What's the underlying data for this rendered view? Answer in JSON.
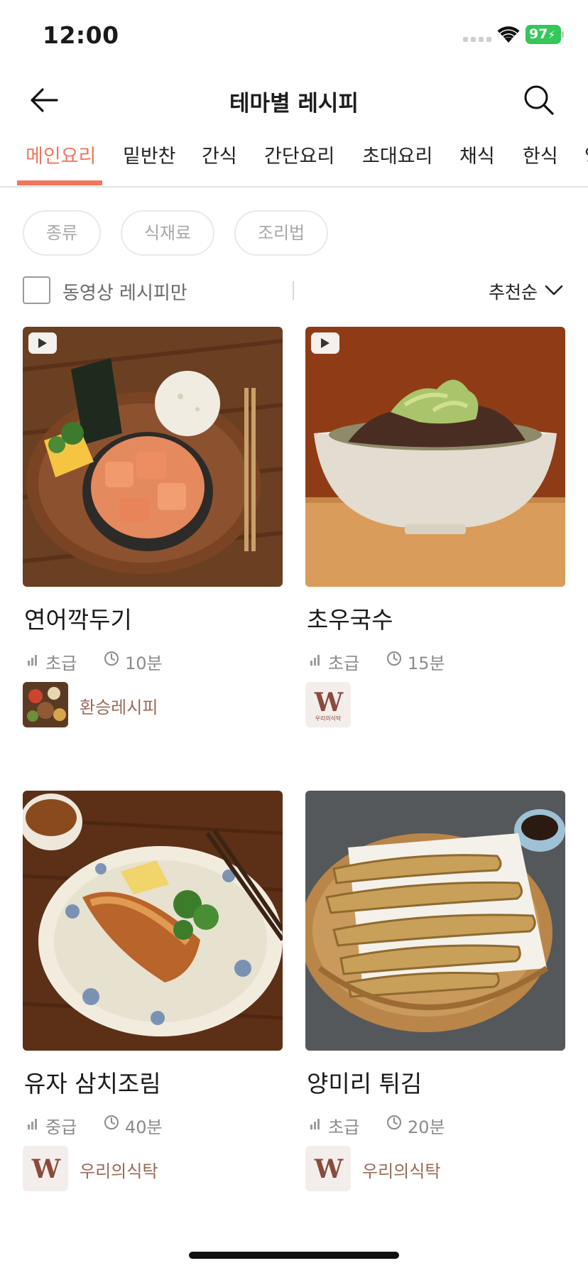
{
  "status_bar": {
    "time": "12:00",
    "battery": "97"
  },
  "header": {
    "title": "테마별 레시피"
  },
  "tabs": [
    {
      "label": "메인요리",
      "active": true
    },
    {
      "label": "밑반찬"
    },
    {
      "label": "간식"
    },
    {
      "label": "간단요리"
    },
    {
      "label": "초대요리"
    },
    {
      "label": "채식"
    },
    {
      "label": "한식"
    },
    {
      "label": "양"
    }
  ],
  "filters": {
    "chips": [
      "종류",
      "식재료",
      "조리법"
    ]
  },
  "options": {
    "video_only_label": "동영상 레시피만",
    "video_only_checked": false,
    "sort_label": "추천순"
  },
  "recipes": [
    {
      "title": "연어깍두기",
      "level": "초급",
      "time": "10분",
      "author": "환승레시피",
      "has_video": true,
      "author_logo": "photo"
    },
    {
      "title": "초우국수",
      "level": "초급",
      "time": "15분",
      "author": "",
      "has_video": true,
      "author_logo": "W",
      "author_logo_sub": "우리의식탁"
    },
    {
      "title": "유자 삼치조림",
      "level": "중급",
      "time": "40분",
      "author": "우리의식탁",
      "has_video": false,
      "author_logo": "W"
    },
    {
      "title": "양미리 튀김",
      "level": "초급",
      "time": "20분",
      "author": "우리의식탁",
      "has_video": false,
      "author_logo": "W"
    }
  ],
  "colors": {
    "accent": "#f0765d",
    "author_text": "#9a6a58",
    "meta_text": "#8b8b8b",
    "battery": "#34c759"
  },
  "icons": [
    "back-arrow-icon",
    "search-icon",
    "play-icon",
    "level-bars-icon",
    "clock-icon",
    "chevron-down-icon",
    "wifi-icon",
    "signal-icon",
    "battery-icon"
  ]
}
